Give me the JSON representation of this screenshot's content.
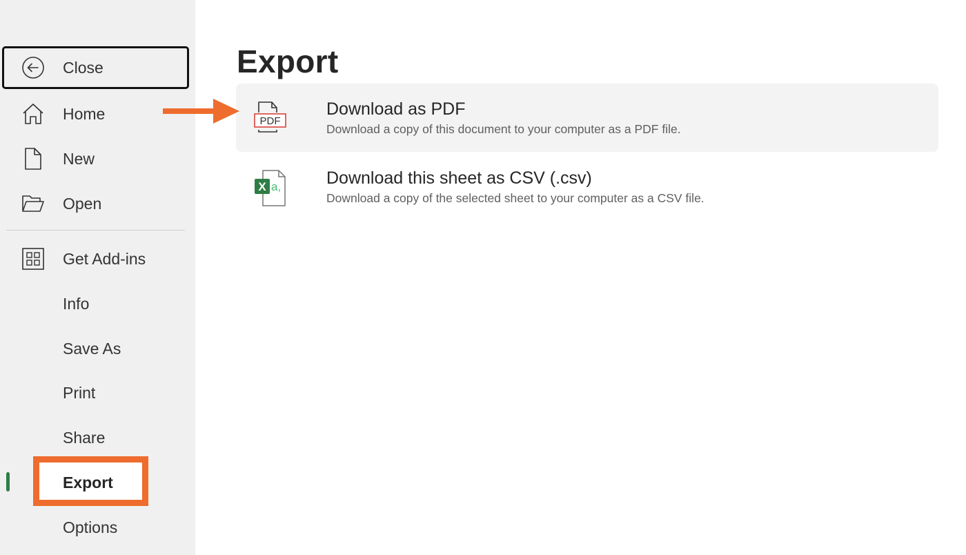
{
  "sidebar": {
    "items": [
      {
        "id": "close",
        "label": "Close",
        "icon": "back-arrow-circle-icon"
      },
      {
        "id": "home",
        "label": "Home",
        "icon": "home-icon"
      },
      {
        "id": "new",
        "label": "New",
        "icon": "new-document-icon"
      },
      {
        "id": "open",
        "label": "Open",
        "icon": "folder-open-icon"
      },
      {
        "id": "get-add-ins",
        "label": "Get Add-ins",
        "icon": "add-ins-grid-icon"
      },
      {
        "id": "info",
        "label": "Info"
      },
      {
        "id": "save-as",
        "label": "Save As"
      },
      {
        "id": "print",
        "label": "Print"
      },
      {
        "id": "share",
        "label": "Share"
      },
      {
        "id": "export",
        "label": "Export",
        "active": true
      },
      {
        "id": "options",
        "label": "Options"
      }
    ]
  },
  "main": {
    "title": "Export",
    "options": [
      {
        "title": "Download as PDF",
        "description": "Download a copy of this document to your computer as a PDF file.",
        "icon": "pdf-file-icon",
        "icon_text": "PDF",
        "selected": true
      },
      {
        "title": "Download this sheet as CSV (.csv)",
        "description": "Download a copy of the selected sheet to your computer as a CSV file.",
        "icon": "excel-csv-file-icon",
        "icon_text_x": "X",
        "icon_text_a": "a,",
        "selected": false
      }
    ]
  },
  "annotations": {
    "highlight_color": "#ee6c2d",
    "highlighted_item": "Export",
    "arrow_target": "Download as PDF"
  },
  "colors": {
    "accent_green": "#2f7d46",
    "sidebar_bg": "#f0f0f0",
    "pdf_red": "#d9423b"
  }
}
